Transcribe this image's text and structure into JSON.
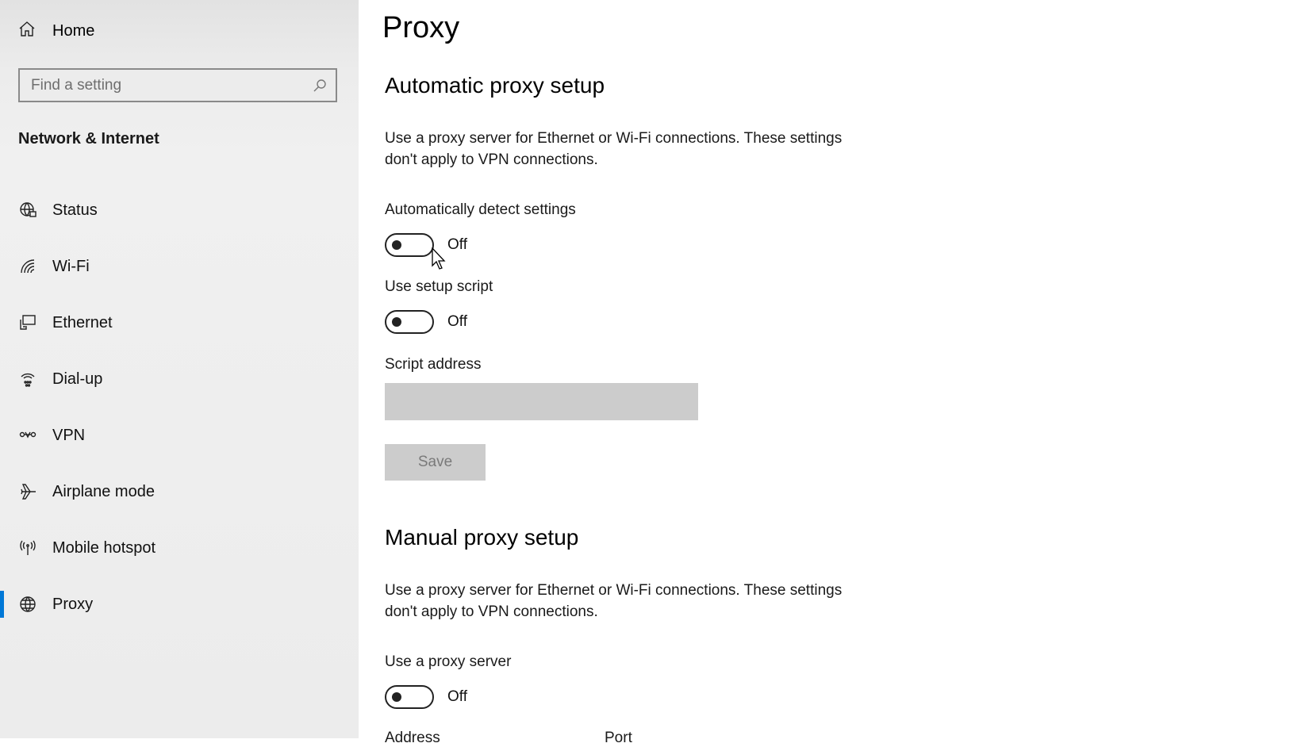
{
  "sidebar": {
    "home_label": "Home",
    "search_placeholder": "Find a setting",
    "section_title": "Network & Internet",
    "items": [
      {
        "label": "Status",
        "icon": "globe-status-icon"
      },
      {
        "label": "Wi-Fi",
        "icon": "wifi-icon"
      },
      {
        "label": "Ethernet",
        "icon": "ethernet-icon"
      },
      {
        "label": "Dial-up",
        "icon": "dialup-icon"
      },
      {
        "label": "VPN",
        "icon": "vpn-icon"
      },
      {
        "label": "Airplane mode",
        "icon": "airplane-icon"
      },
      {
        "label": "Mobile hotspot",
        "icon": "hotspot-icon"
      },
      {
        "label": "Proxy",
        "icon": "globe-icon",
        "active": true
      }
    ],
    "accent": "#0078d7"
  },
  "main": {
    "title": "Proxy",
    "auto": {
      "heading": "Automatic proxy setup",
      "description": "Use a proxy server for Ethernet or Wi-Fi connections. These settings don't apply to VPN connections.",
      "detect_label": "Automatically detect settings",
      "detect_state": "Off",
      "script_label": "Use setup script",
      "script_state": "Off",
      "address_label": "Script address",
      "address_value": "",
      "save_label": "Save"
    },
    "manual": {
      "heading": "Manual proxy setup",
      "description": "Use a proxy server for Ethernet or Wi-Fi connections. These settings don't apply to VPN connections.",
      "use_proxy_label": "Use a proxy server",
      "use_proxy_state": "Off",
      "address_label": "Address",
      "port_label": "Port"
    }
  }
}
